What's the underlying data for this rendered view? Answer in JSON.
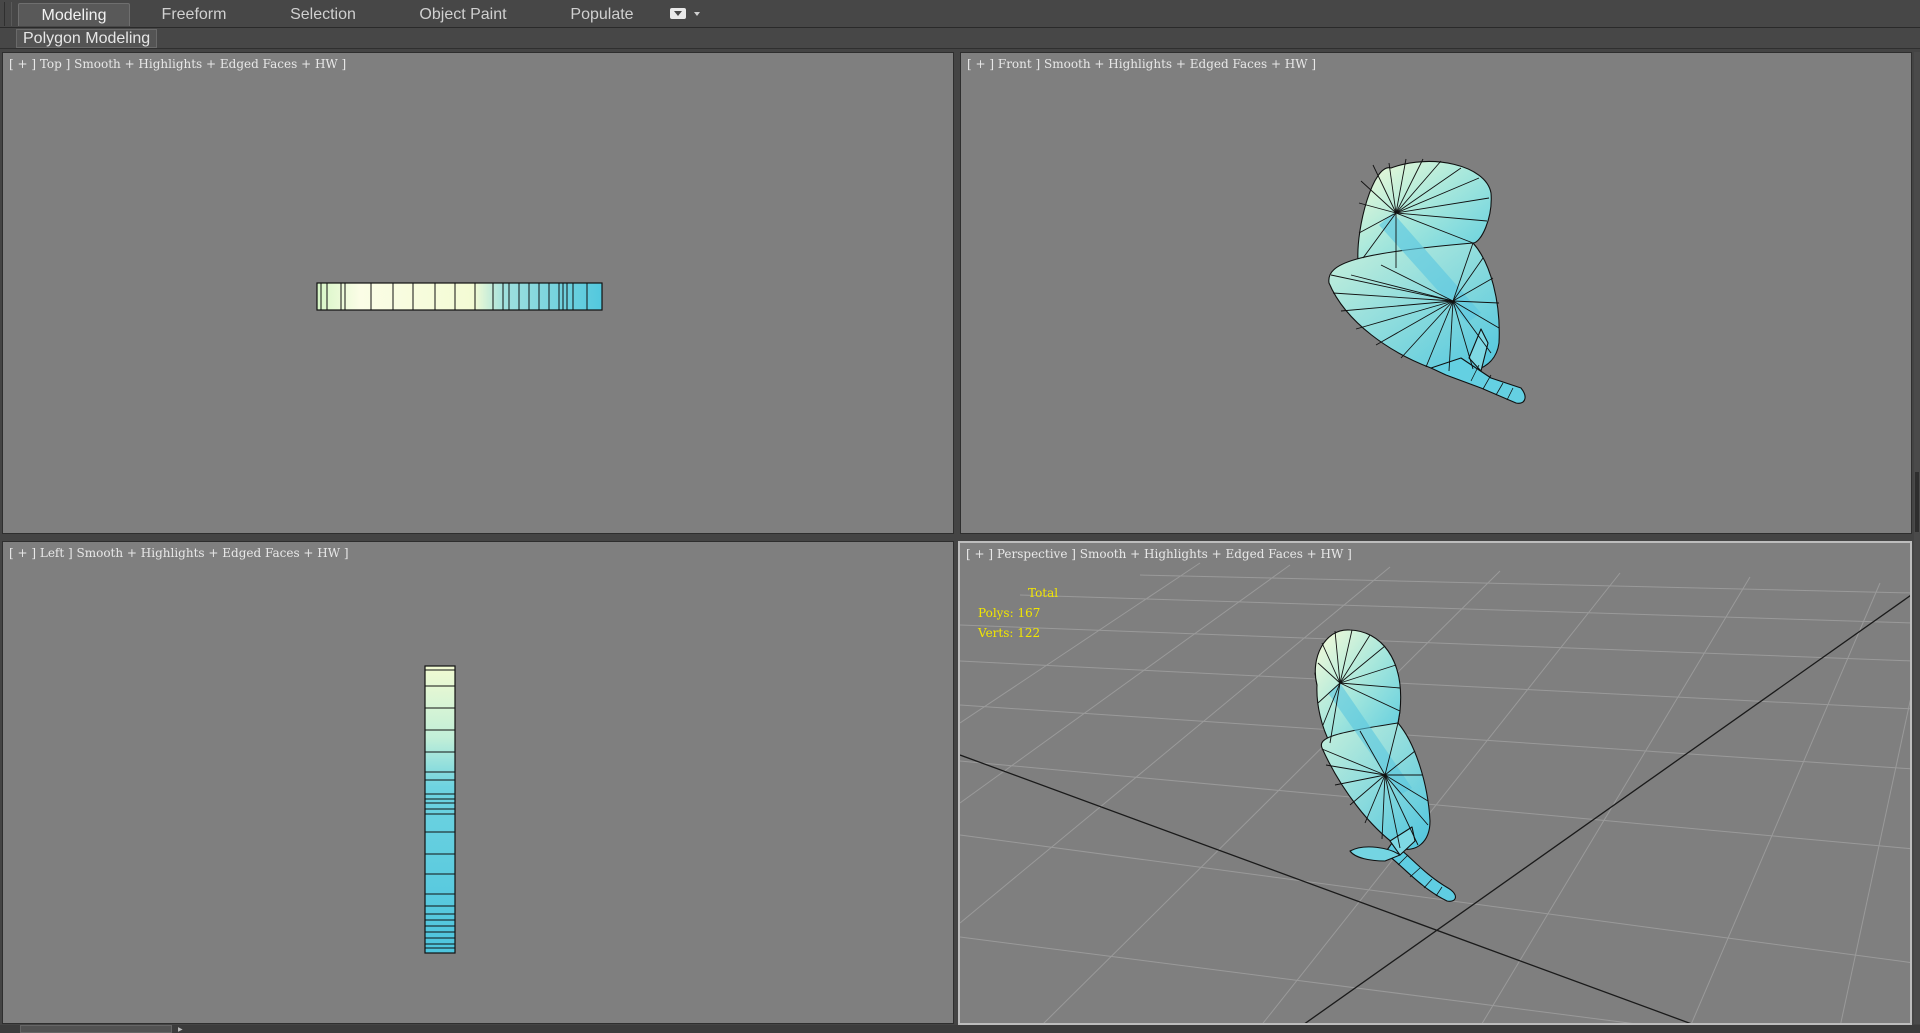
{
  "ribbon": {
    "tabs": [
      {
        "label": "Modeling",
        "active": true
      },
      {
        "label": "Freeform",
        "active": false
      },
      {
        "label": "Selection",
        "active": false
      },
      {
        "label": "Object Paint",
        "active": false
      },
      {
        "label": "Populate",
        "active": false
      }
    ],
    "options_icon": "dropdown-toggle-icon",
    "panel_label": "Polygon Modeling"
  },
  "viewports": {
    "top": {
      "label": "[ + ] Top ] Smooth + Highlights + Edged Faces + HW ]"
    },
    "front": {
      "label": "[ + ] Front ] Smooth + Highlights + Edged Faces + HW ]"
    },
    "left": {
      "label": "[ + ] Left ] Smooth + Highlights + Edged Faces + HW ]"
    },
    "perspective": {
      "label": "[ + ] Perspective ] Smooth + Highlights + Edged Faces + HW ]",
      "stats": {
        "title": "Total",
        "polys": "Polys: 167",
        "verts": "Verts: 122"
      }
    }
  },
  "colors": {
    "viewport_bg": "#7f7f7f",
    "ui_bg": "#444444",
    "leaf_light": "#f2fbd8",
    "leaf_dark": "#4ec6dc",
    "stats_text": "#f2e600",
    "active_border": "#bdbdbd"
  }
}
